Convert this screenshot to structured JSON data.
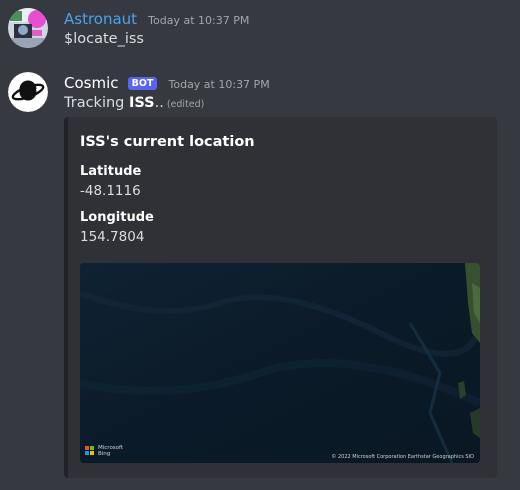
{
  "messages": [
    {
      "username": "Astronaut",
      "username_color": "#4aa3f0",
      "timestamp": "Today at 10:37 PM",
      "content": "$locate_iss",
      "avatar_icon": "astronaut-avatar-icon"
    },
    {
      "username": "Cosmic",
      "username_color": "#ffffff",
      "bot_tag": "BOT",
      "timestamp": "Today at 10:37 PM",
      "content_prefix": "Tracking ",
      "content_bold": "ISS",
      "content_suffix": "..",
      "edited": "(edited)",
      "avatar_icon": "planet-avatar-icon",
      "embed": {
        "title": "ISS's current location",
        "fields": [
          {
            "name": "Latitude",
            "value": "-48.1116"
          },
          {
            "name": "Longitude",
            "value": "154.7804"
          }
        ],
        "map": {
          "attribution_logo_line1": "Microsoft",
          "attribution_logo_line2": "Bing",
          "copyright": "© 2022 Microsoft Corporation Earthstar Geographics SIO"
        }
      }
    }
  ]
}
